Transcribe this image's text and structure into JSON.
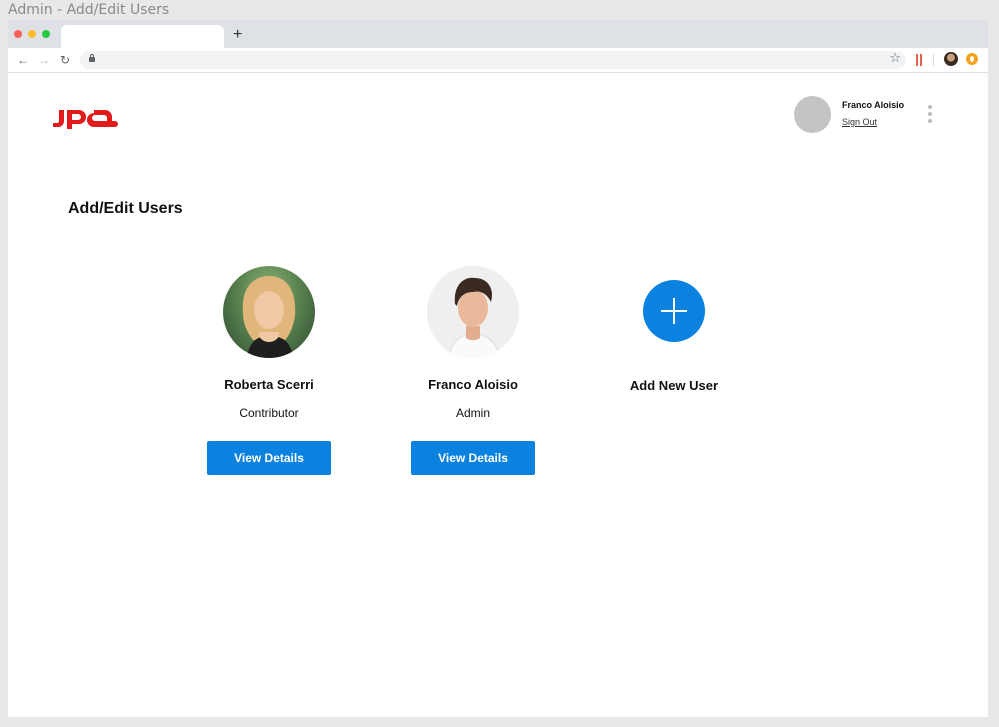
{
  "window": {
    "title": "Admin - Add/Edit Users"
  },
  "browser": {
    "new_tab_label": "+",
    "url": ""
  },
  "header": {
    "logo_text": "JPA",
    "brand_color": "#e21a1a",
    "account": {
      "name": "Franco Aloisio",
      "sign_out": "Sign Out"
    }
  },
  "main": {
    "title": "Add/Edit Users",
    "users": [
      {
        "name": "Roberta Scerri",
        "role": "Contributor",
        "button_label": "View Details"
      },
      {
        "name": "Franco Aloisio",
        "role": "Admin",
        "button_label": "View Details"
      }
    ],
    "add_user": {
      "label": "Add New User"
    },
    "accent_color": "#0b82e0"
  }
}
